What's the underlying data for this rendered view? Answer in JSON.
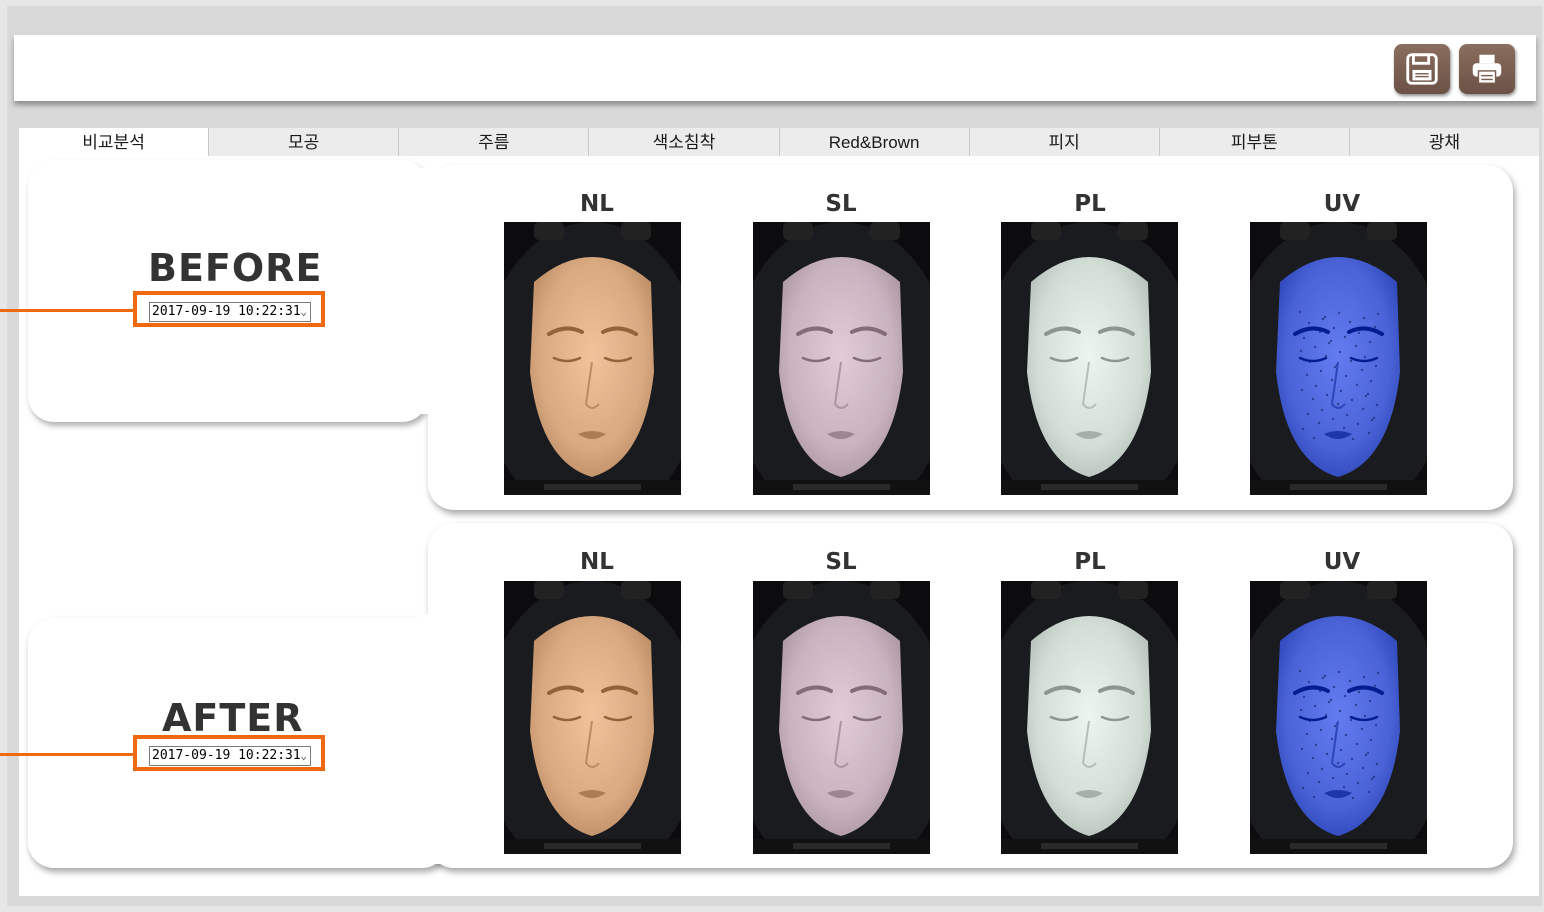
{
  "toolbar": {
    "save_icon": "floppy-disk-icon",
    "print_icon": "printer-icon",
    "button_color": "#7a5f51"
  },
  "tabs": [
    {
      "label": "비교분석",
      "active": true
    },
    {
      "label": "모공",
      "active": false
    },
    {
      "label": "주름",
      "active": false
    },
    {
      "label": "색소침착",
      "active": false
    },
    {
      "label": "Red&Brown",
      "active": false
    },
    {
      "label": "피지",
      "active": false
    },
    {
      "label": "피부톤",
      "active": false
    },
    {
      "label": "광채",
      "active": false
    }
  ],
  "before": {
    "label": "BEFORE",
    "date": "2017-09-19 10:22:31",
    "images": [
      "NL",
      "SL",
      "PL",
      "UV"
    ]
  },
  "after": {
    "label": "AFTER",
    "date": "2017-09-19 10:22:31",
    "images": [
      "NL",
      "SL",
      "PL",
      "UV"
    ]
  },
  "highlight_color": "#f0690f",
  "image_tints": {
    "NL": "#d9a982",
    "SL": "#c8b3bf",
    "PL": "#d2ddd6",
    "UV": "#4a63d6"
  }
}
